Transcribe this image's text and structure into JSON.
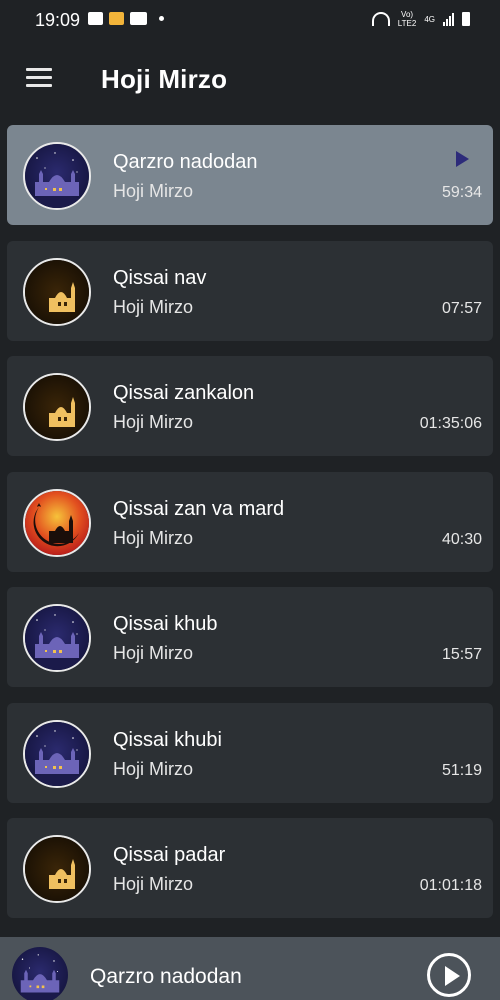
{
  "status_bar": {
    "time": "19:09",
    "network_label_1": "Vo)",
    "network_label_2": "LTE2",
    "network_type": "4G"
  },
  "header": {
    "title": "Hoji Mirzo"
  },
  "tracks": [
    {
      "title": "Qarzro nadodan",
      "artist": "Hoji Mirzo",
      "duration": "59:34",
      "thumb": "night-mosque",
      "active": true
    },
    {
      "title": "Qissai nav",
      "artist": "Hoji Mirzo",
      "duration": "07:57",
      "thumb": "golden-crescent-mosque",
      "active": false
    },
    {
      "title": "Qissai zankalon",
      "artist": "Hoji Mirzo",
      "duration": "01:35:06",
      "thumb": "golden-crescent-mosque",
      "active": false
    },
    {
      "title": "Qissai zan va mard",
      "artist": "Hoji Mirzo",
      "duration": "40:30",
      "thumb": "red-crescent-mosque",
      "active": false
    },
    {
      "title": "Qissai khub",
      "artist": "Hoji Mirzo",
      "duration": "15:57",
      "thumb": "night-mosque",
      "active": false
    },
    {
      "title": "Qissai khubi",
      "artist": "Hoji Mirzo",
      "duration": "51:19",
      "thumb": "night-mosque",
      "active": false
    },
    {
      "title": "Qissai padar",
      "artist": "Hoji Mirzo",
      "duration": "01:01:18",
      "thumb": "golden-crescent-mosque",
      "active": false
    }
  ],
  "mini_player": {
    "title": "Qarzro nadodan",
    "thumb": "night-mosque"
  },
  "colors": {
    "background": "#1f2225",
    "card": "#2c3034",
    "card_active": "#7b8690",
    "mini_player": "#4c535a",
    "playing_indicator": "#2d2b7a"
  }
}
